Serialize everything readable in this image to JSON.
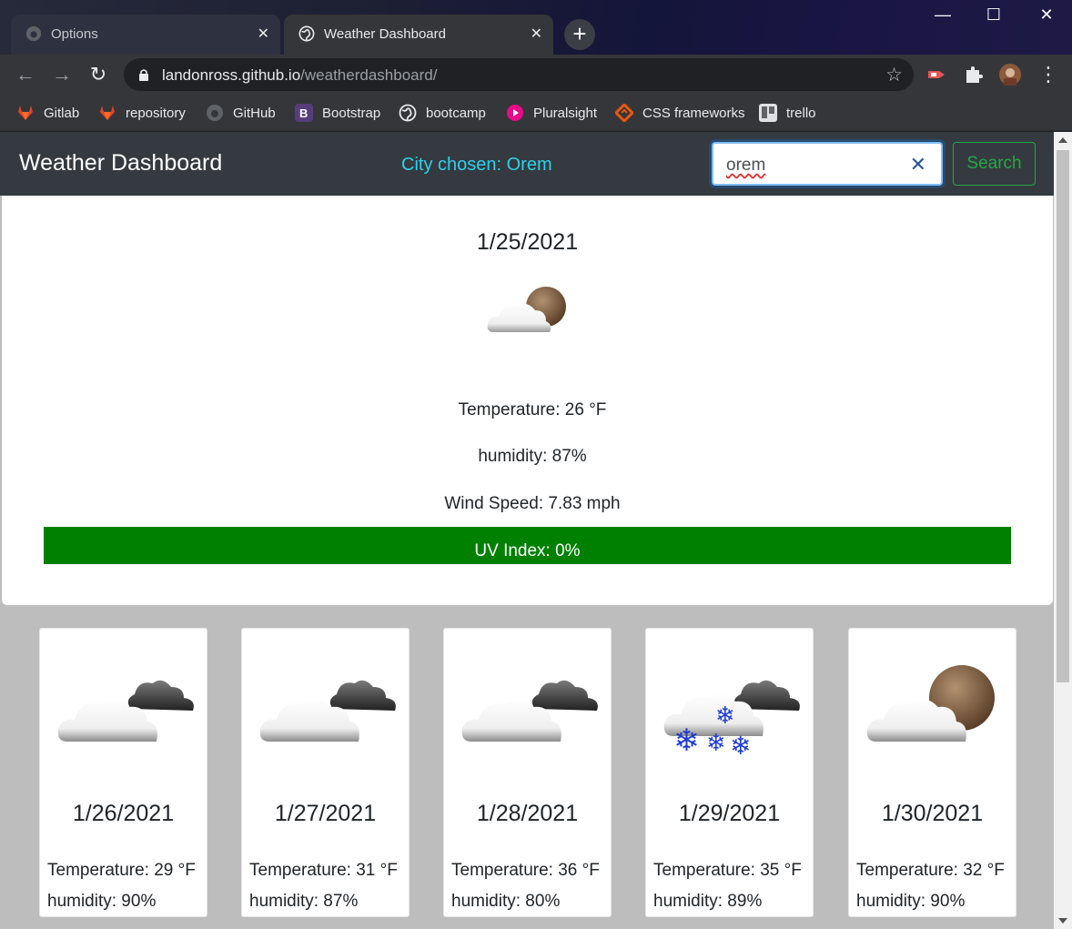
{
  "browser": {
    "tabs": [
      {
        "title": "Options",
        "icon": "github-icon"
      },
      {
        "title": "Weather Dashboard",
        "icon": "globe-icon"
      }
    ],
    "url_host": "landonross.github.io",
    "url_path": "/weatherdashboard/",
    "bookmarks": [
      {
        "label": "Gitlab",
        "icon": "gitlab-icon",
        "color": "#e24329"
      },
      {
        "label": "repository",
        "icon": "gitlab-icon",
        "color": "#e24329"
      },
      {
        "label": "GitHub",
        "icon": "github-icon",
        "color": "#ffffff"
      },
      {
        "label": "Bootstrap",
        "icon": "bootstrap-icon",
        "color": "#563d7c"
      },
      {
        "label": "bootcamp",
        "icon": "globe-icon",
        "color": "#ffffff"
      },
      {
        "label": "Pluralsight",
        "icon": "pluralsight-icon",
        "color": "#f15b2a"
      },
      {
        "label": "CSS frameworks",
        "icon": "diamond-icon",
        "color": "#e8590c"
      },
      {
        "label": "trello",
        "icon": "trello-icon",
        "color": "#0079bf"
      }
    ]
  },
  "app": {
    "brand": "Weather Dashboard",
    "city_label": "City chosen: Orem",
    "search_value": "orem",
    "search_button": "Search",
    "current": {
      "date": "1/25/2021",
      "icon": "partly-cloudy-night-icon",
      "temperature": "Temperature: 26 °F",
      "humidity": "humidity: 87%",
      "wind": "Wind Speed: 7.83 mph",
      "uv": "UV Index: 0%",
      "uv_color": "#008000"
    },
    "forecast": [
      {
        "date": "1/26/2021",
        "temp": "Temperature: 29 °F",
        "humidity": "humidity: 90%",
        "icon": "broken-clouds-icon"
      },
      {
        "date": "1/27/2021",
        "temp": "Temperature: 31 °F",
        "humidity": "humidity: 87%",
        "icon": "broken-clouds-icon"
      },
      {
        "date": "1/28/2021",
        "temp": "Temperature: 36 °F",
        "humidity": "humidity: 80%",
        "icon": "broken-clouds-icon"
      },
      {
        "date": "1/29/2021",
        "temp": "Temperature: 35 °F",
        "humidity": "humidity: 89%",
        "icon": "snow-icon"
      },
      {
        "date": "1/30/2021",
        "temp": "Temperature: 32 °F",
        "humidity": "humidity: 90%",
        "icon": "partly-cloudy-night-icon"
      }
    ]
  }
}
